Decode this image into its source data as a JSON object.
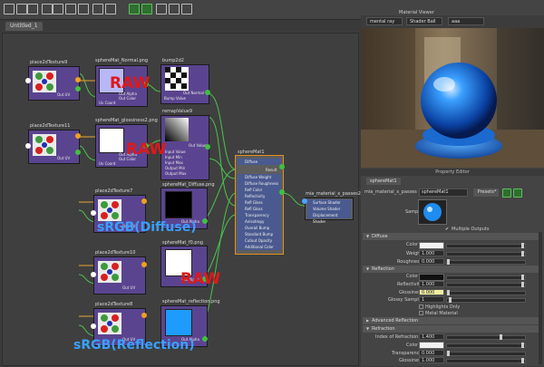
{
  "tabs": {
    "graph_tab": "Untitled_1"
  },
  "nodes": {
    "place1": {
      "title": "place2dTexture9",
      "port": "Out UV"
    },
    "file1": {
      "title": "sphereMat_Normal.png",
      "out_alpha": "Out Alpha",
      "out_color": "Out Color",
      "uv_coord": "Uv Coord"
    },
    "bump": {
      "title": "bump2d2",
      "out_normal": "Out Normal",
      "bump_value": "Bump Value"
    },
    "place2": {
      "title": "place2dTexture11",
      "port": "Out UV"
    },
    "file2": {
      "title": "sphereMat_glossiness2.png",
      "out_alpha": "Out Alpha",
      "out_color": "Out Color",
      "uv_coord": "Uv Coord"
    },
    "remap": {
      "title": "remapValue9",
      "ports": [
        "Out Value",
        "Input Value",
        "Input Min",
        "Input Max",
        "Output Min",
        "Output Max"
      ]
    },
    "place3": {
      "title": "place2dTexture7",
      "port": "Out UV"
    },
    "file3": {
      "title": "sphereMat_Diffuse.png",
      "out_alpha": "Out Alpha"
    },
    "place4": {
      "title": "place2dTexture10",
      "port": "Out UV"
    },
    "file4": {
      "title": "sphereMat_f0.png",
      "out_alpha": "Out Alpha"
    },
    "place5": {
      "title": "place2dTexture8",
      "port": "Out UV"
    },
    "file5": {
      "title": "sphereMat_reflection.png",
      "out_alpha": "Out Alpha"
    },
    "mat": {
      "title": "sphereMat1",
      "result": "Result",
      "ports": [
        "Diffuse",
        "Diffuse Weight",
        "Diffuse Roughness",
        "Refl Color",
        "Reflectivity",
        "Refl Gloss",
        "Refl Gloss",
        "Transparency",
        "Anisotropy",
        "Overall Bump",
        "Standard Bump",
        "Cutout Opacity",
        "Additional Color"
      ]
    },
    "sg": {
      "title": "mia_material_x_passes2SG",
      "ports": [
        "Surface Shader",
        "Volume Shader",
        "Displacement Shader"
      ]
    }
  },
  "annotations": {
    "raw1": "RAW",
    "raw2": "RAW",
    "raw3": "RAW",
    "srgb_diffuse": "sRGB(Diffuse)",
    "srgb_reflection": "sRGB(Reflection)"
  },
  "render_view": {
    "title": "Material Viewer",
    "renderer": "mental ray",
    "shape": "Shader Ball",
    "env": "aaa"
  },
  "property_editor": {
    "title": "Property Editor",
    "tab": "sphereMat1",
    "type": "mia_material_x_passes",
    "name": "sphereMat1",
    "presets": "Presets*",
    "sample_label": "Sample",
    "multiple_outputs": "Multiple Outputs",
    "sections": {
      "diffuse": "Diffuse",
      "reflection": "Reflection",
      "adv_refl": "Advanced Reflection",
      "refraction": "Refraction"
    },
    "diffuse": {
      "color_label": "Color",
      "weight_label": "Weight",
      "weight": "1.000",
      "rough_label": "Roughness",
      "rough": "0.000"
    },
    "reflection": {
      "color_label": "Color",
      "refl_label": "Reflectivity",
      "refl": "1.000",
      "gloss_label": "Glossiness",
      "gloss": "0.000",
      "samples_label": "Glossy Samples",
      "samples": "1",
      "highlights": "Highlights Only",
      "metal": "Metal Material"
    },
    "refraction": {
      "ior_label": "Index of Refraction",
      "ior": "1.400",
      "color_label": "Color",
      "transp_label": "Transparency",
      "transp": "0.000",
      "gloss_label": "Glossiness",
      "gloss": "1.000"
    },
    "colors": {
      "diffuse_color": "#f2f2f2",
      "refl_color": "#111111",
      "refr_color": "#f2f2f2"
    }
  }
}
